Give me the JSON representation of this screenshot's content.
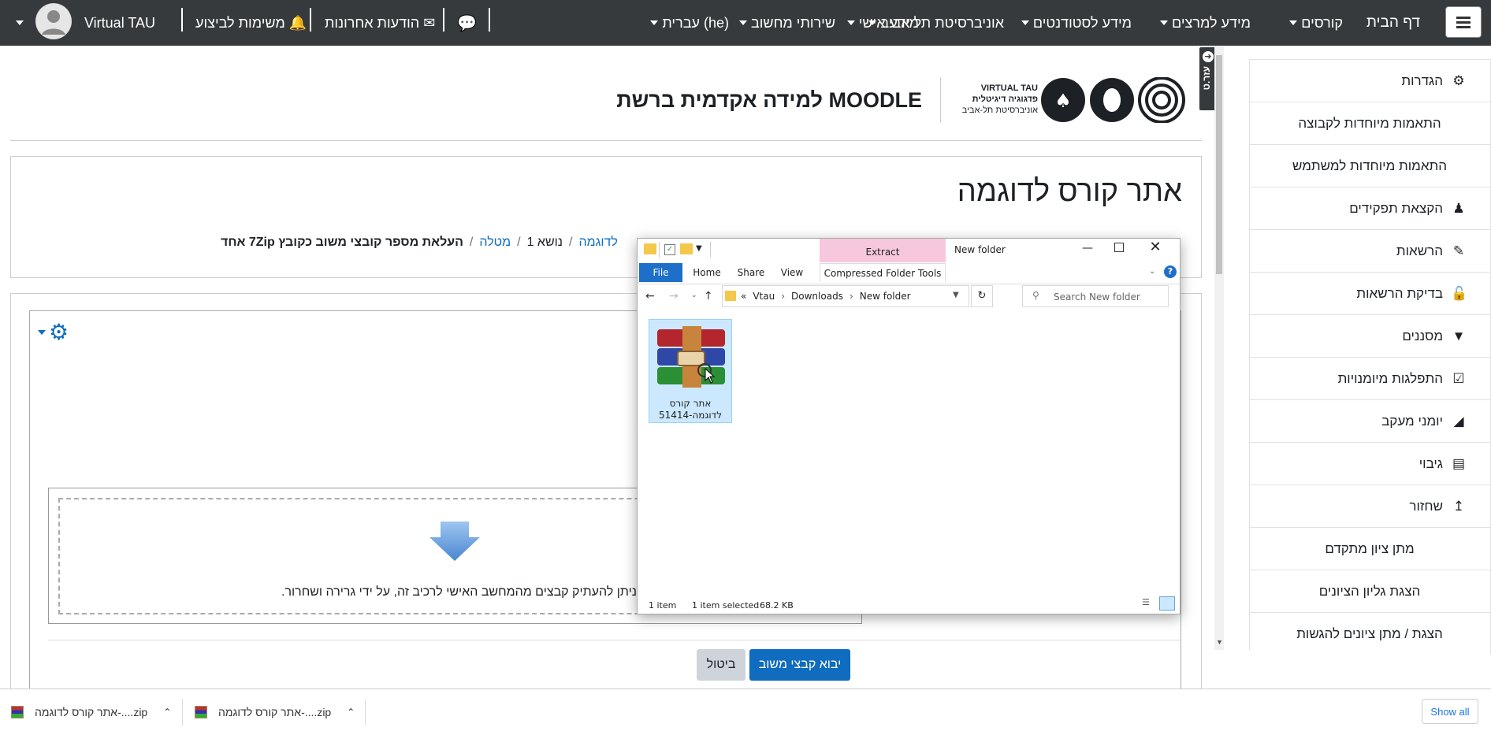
{
  "navbar": {
    "home": "דף הבית",
    "menus": [
      "קורסים",
      "מידע למרצים",
      "מידע לסטודנטים",
      "אוניברסיטת תל אביב",
      "מידע אישי",
      "שירותי מחשוב",
      "עברית (he)"
    ],
    "messages_label": "הודעות אחרונות",
    "tasks_label": "משימות לביצוע",
    "user_name": "Virtual TAU"
  },
  "header": {
    "logo_line1": "VIRTUAL TAU",
    "logo_line2": "פדגוגיה דיגיטלית",
    "logo_line3": "אוניברסיטת תל-אביב",
    "site_title": "למידה אקדמית ברשת MOODLE",
    "side_tab": "עזר.ט"
  },
  "course": {
    "title": "אתר קורס לדוגמה",
    "breadcrumb": [
      "לדוגמה",
      "נושא 1",
      "מטלה",
      "העלאת מספר קובצי משוב כקובץ 7Zip אחד"
    ]
  },
  "upload": {
    "drop_text": "ניתן להעתיק קבצים מהמחשב האישי לרכיב זה, על ידי גרירה ושחרור.",
    "import_button": "יבוא קבצי משוב",
    "cancel_button": "ביטול"
  },
  "sidebar": {
    "items": [
      {
        "label": "הגדרות",
        "icon": "gear-icon"
      },
      {
        "label": "התאמות מיוחדות לקבוצה",
        "icon": ""
      },
      {
        "label": "התאמות מיוחדות למשתמש",
        "icon": ""
      },
      {
        "label": "הקצאת תפקידים",
        "icon": "user-tag-icon"
      },
      {
        "label": "הרשאות",
        "icon": "edit-icon"
      },
      {
        "label": "בדיקת הרשאות",
        "icon": "lock-icon"
      },
      {
        "label": "מסננים",
        "icon": "filter-icon"
      },
      {
        "label": "התפלגות מיומנויות",
        "icon": "checkbox-icon"
      },
      {
        "label": "יומני מעקב",
        "icon": "chart-area-icon"
      },
      {
        "label": "גיבוי",
        "icon": "file-archive-icon"
      },
      {
        "label": "שחזור",
        "icon": "upload-icon"
      },
      {
        "label": "מתן ציון מתקדם",
        "icon": ""
      },
      {
        "label": "הצגת גליון הציונים",
        "icon": ""
      },
      {
        "label": "הצגת / מתן ציונים להגשות",
        "icon": ""
      }
    ]
  },
  "explorer": {
    "window_title": "New folder",
    "extract_tab": "Extract",
    "compressed_tools": "Compressed Folder Tools",
    "ribbon_tabs": [
      "File",
      "Home",
      "Share",
      "View"
    ],
    "path": [
      "Vtau",
      "Downloads",
      "New folder"
    ],
    "path_prefix": "«",
    "search_placeholder": "Search New folder",
    "file_name_line1": "אתר קורס",
    "file_name_line2": "לדוגמה-51414",
    "status_items": "1 item",
    "status_selected": "1 item selected",
    "status_size": "68.2 KB"
  },
  "downloads": {
    "items": [
      "אתר קורס לדוגמה-....zip",
      "אתר קורס לדוגמה-....zip"
    ],
    "show_all": "Show all"
  },
  "colors": {
    "navbar": "#373a3c",
    "primary": "#0f6cbf",
    "link": "#0f6cbf",
    "extract_tab_bg": "#f7c8dd"
  }
}
